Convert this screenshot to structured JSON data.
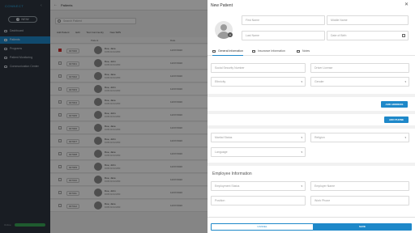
{
  "sidebar": {
    "brand": "CONNECT",
    "new_label": "NEW",
    "items": [
      {
        "label": "Dashboard",
        "icon": "dashboard-icon"
      },
      {
        "label": "Patients",
        "icon": "patients-icon"
      },
      {
        "label": "Programs",
        "icon": "programs-icon"
      },
      {
        "label": "Patient Monitoring",
        "icon": "monitoring-icon"
      },
      {
        "label": "Communication Center",
        "icon": "communication-icon"
      }
    ],
    "footer_label": "Online"
  },
  "main": {
    "title": "Patients",
    "search_placeholder": "Search Patient",
    "toolbar": [
      "Add Patient",
      "Edit",
      "Text Community",
      "New SMS"
    ],
    "headers": [
      "Patient",
      "Date"
    ],
    "rows": [
      {
        "id": "#27000",
        "name": "Doe, Jane",
        "sub": "DOB 01/01/1950",
        "date": "12/07/2020",
        "checked": true
      },
      {
        "id": "#27001",
        "name": "Doe, John",
        "sub": "DOB 01/01/1950",
        "date": "12/07/2020",
        "checked": false
      },
      {
        "id": "#27002",
        "name": "Doe, Jane",
        "sub": "DOB 01/01/1950",
        "date": "12/07/2020",
        "checked": false
      },
      {
        "id": "#27003",
        "name": "Doe, John",
        "sub": "DOB 01/01/1950",
        "date": "12/07/2020",
        "checked": false
      },
      {
        "id": "#27004",
        "name": "Doe, Jane",
        "sub": "DOB 01/01/1950",
        "date": "12/07/2020",
        "checked": false
      },
      {
        "id": "#27005",
        "name": "Doe, John",
        "sub": "DOB 01/01/1950",
        "date": "12/07/2020",
        "checked": false
      },
      {
        "id": "#27006",
        "name": "Doe, Jane",
        "sub": "DOB 01/01/1950",
        "date": "12/07/2020",
        "checked": false
      },
      {
        "id": "#27007",
        "name": "Doe, John",
        "sub": "DOB 01/01/1950",
        "date": "12/07/2020",
        "checked": false
      },
      {
        "id": "#27008",
        "name": "Doe, Jane",
        "sub": "DOB 01/01/1950",
        "date": "12/07/2020",
        "checked": false
      },
      {
        "id": "#27009",
        "name": "Doe, John",
        "sub": "DOB 01/01/1950",
        "date": "12/07/2020",
        "checked": false
      },
      {
        "id": "#27010",
        "name": "Doe, Jane",
        "sub": "DOB 01/01/1950",
        "date": "12/07/2020",
        "checked": false
      },
      {
        "id": "#27011",
        "name": "Doe, John",
        "sub": "DOB 01/01/1950",
        "date": "12/07/2020",
        "checked": false
      },
      {
        "id": "#27012",
        "name": "Doe, Jane",
        "sub": "DOB 01/01/1950",
        "date": "12/07/2020",
        "checked": false
      }
    ]
  },
  "panel": {
    "title": "New Patient",
    "first_name": "First Name",
    "middle_name": "Middle Name",
    "last_name": "Last Name",
    "dob": "Date of Birth",
    "tabs": [
      "General Information",
      "Insurance Information",
      "Notes"
    ],
    "ssn": "Social Security Number",
    "drivers_license": "Driver License",
    "ethnicity": "Ethnicity",
    "gender": "Gender",
    "add_address": "ADD ADDRESS",
    "add_phone": "ADD PHONE",
    "marital_status": "Marital Status",
    "religion": "Religion",
    "language": "Language",
    "employee_section": "Employee Information",
    "employment_status": "Employment Status",
    "employer_name": "Employer Name",
    "position": "Position",
    "work_phone": "Work Phone",
    "cancel": "CANCEL",
    "save": "SAVE"
  },
  "colors": {
    "accent": "#1e88c9",
    "sidebar": "#2f3640"
  }
}
